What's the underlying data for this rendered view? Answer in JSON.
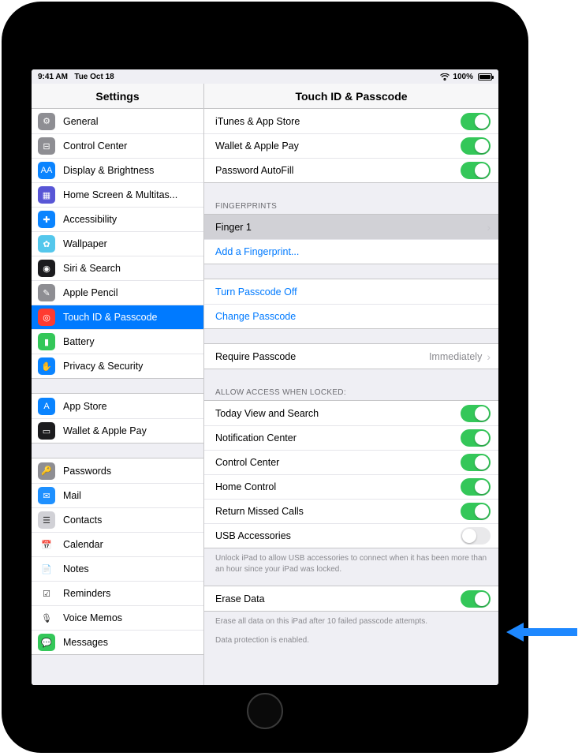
{
  "status": {
    "time": "9:41 AM",
    "date": "Tue Oct 18",
    "battery_pct": "100%"
  },
  "header": {
    "left_title": "Settings",
    "right_title": "Touch ID & Passcode"
  },
  "sidebar": {
    "group1": [
      {
        "label": "General",
        "icon_color": "#8e8e93",
        "glyph": "⚙"
      },
      {
        "label": "Control Center",
        "icon_color": "#8e8e93",
        "glyph": "⊟"
      },
      {
        "label": "Display & Brightness",
        "icon_color": "#0a84ff",
        "glyph": "AA"
      },
      {
        "label": "Home Screen & Multitas...",
        "icon_color": "#5856d6",
        "glyph": "▦"
      },
      {
        "label": "Accessibility",
        "icon_color": "#0a84ff",
        "glyph": "✚"
      },
      {
        "label": "Wallpaper",
        "icon_color": "#54c7ec",
        "glyph": "✿"
      },
      {
        "label": "Siri & Search",
        "icon_color": "#1b1b1e",
        "glyph": "◉"
      },
      {
        "label": "Apple Pencil",
        "icon_color": "#8e8e93",
        "glyph": "✎"
      },
      {
        "label": "Touch ID & Passcode",
        "icon_color": "#ff3b30",
        "glyph": "◎",
        "selected": true
      },
      {
        "label": "Battery",
        "icon_color": "#34c759",
        "glyph": "▮"
      },
      {
        "label": "Privacy & Security",
        "icon_color": "#0a84ff",
        "glyph": "✋"
      }
    ],
    "group2": [
      {
        "label": "App Store",
        "icon_color": "#0a84ff",
        "glyph": "A"
      },
      {
        "label": "Wallet & Apple Pay",
        "icon_color": "#1c1c1e",
        "glyph": "▭"
      }
    ],
    "group3": [
      {
        "label": "Passwords",
        "icon_color": "#8e8e93",
        "glyph": "🔑"
      },
      {
        "label": "Mail",
        "icon_color": "#1e90ff",
        "glyph": "✉"
      },
      {
        "label": "Contacts",
        "icon_color": "#d1d1d6",
        "glyph": "☰"
      },
      {
        "label": "Calendar",
        "icon_color": "#ffffff",
        "glyph": "📅"
      },
      {
        "label": "Notes",
        "icon_color": "#ffffff",
        "glyph": "📄"
      },
      {
        "label": "Reminders",
        "icon_color": "#ffffff",
        "glyph": "☑"
      },
      {
        "label": "Voice Memos",
        "icon_color": "#ffffff",
        "glyph": "🎙"
      },
      {
        "label": "Messages",
        "icon_color": "#34c759",
        "glyph": "💬"
      }
    ]
  },
  "main": {
    "use_for": [
      {
        "label": "iTunes & App Store",
        "on": true
      },
      {
        "label": "Wallet & Apple Pay",
        "on": true
      },
      {
        "label": "Password AutoFill",
        "on": true
      }
    ],
    "fingerprints_header": "Fingerprints",
    "fingerprints": [
      {
        "label": "Finger 1",
        "detail": true,
        "highlighted": true
      },
      {
        "label": "Add a Fingerprint...",
        "link": true
      }
    ],
    "passcode_actions": [
      {
        "label": "Turn Passcode Off"
      },
      {
        "label": "Change Passcode"
      }
    ],
    "require": {
      "label": "Require Passcode",
      "value": "Immediately"
    },
    "allow_header": "Allow Access When Locked:",
    "allow_items": [
      {
        "label": "Today View and Search",
        "on": true
      },
      {
        "label": "Notification Center",
        "on": true
      },
      {
        "label": "Control Center",
        "on": true
      },
      {
        "label": "Home Control",
        "on": true
      },
      {
        "label": "Return Missed Calls",
        "on": true
      },
      {
        "label": "USB Accessories",
        "on": false
      }
    ],
    "usb_footer": "Unlock iPad to allow USB accessories to connect when it has been more than an hour since your iPad was locked.",
    "erase": {
      "label": "Erase Data",
      "on": true
    },
    "erase_footer1": "Erase all data on this iPad after 10 failed passcode attempts.",
    "erase_footer2": "Data protection is enabled."
  }
}
